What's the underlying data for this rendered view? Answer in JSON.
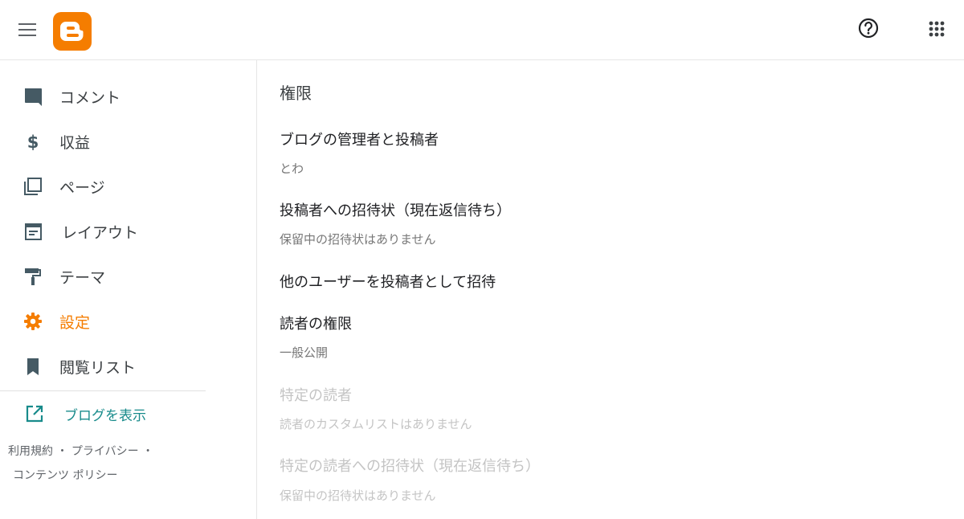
{
  "header": {
    "menu_icon": "hamburger-menu-icon",
    "logo": "blogger-logo",
    "help_icon": "help-circle-icon",
    "apps_icon": "apps-grid-icon",
    "accent_color": "#f57d00"
  },
  "sidebar": {
    "items": [
      {
        "label": "コメント",
        "icon": "comment-icon"
      },
      {
        "label": "収益",
        "icon": "dollar-icon"
      },
      {
        "label": "ページ",
        "icon": "pages-icon"
      },
      {
        "label": "レイアウト",
        "icon": "layout-icon"
      },
      {
        "label": "テーマ",
        "icon": "paint-roller-icon"
      },
      {
        "label": "設定",
        "icon": "gear-icon",
        "active": true
      },
      {
        "label": "閲覧リスト",
        "icon": "bookmark-icon"
      }
    ],
    "view_blog": {
      "label": "ブログを表示",
      "icon": "open-in-new-icon"
    },
    "footer": {
      "terms": "利用規約",
      "privacy": "プライバシー",
      "policy": "コンテンツ ポリシー",
      "sep": "・"
    }
  },
  "main": {
    "section_title": "権限",
    "admins_title": "ブログの管理者と投稿者",
    "admins_value": "とわ",
    "pending_title": "投稿者への招待状（現在返信待ち）",
    "pending_value": "保留中の招待状はありません",
    "invite_title": "他のユーザーを投稿者として招待",
    "readers_title": "読者の権限",
    "readers_value": "一般公開",
    "specific_readers_title": "特定の読者",
    "specific_readers_value": "読者のカスタムリストはありません",
    "reader_invites_title": "特定の読者への招待状（現在返信待ち）",
    "reader_invites_value": "保留中の招待状はありません"
  }
}
